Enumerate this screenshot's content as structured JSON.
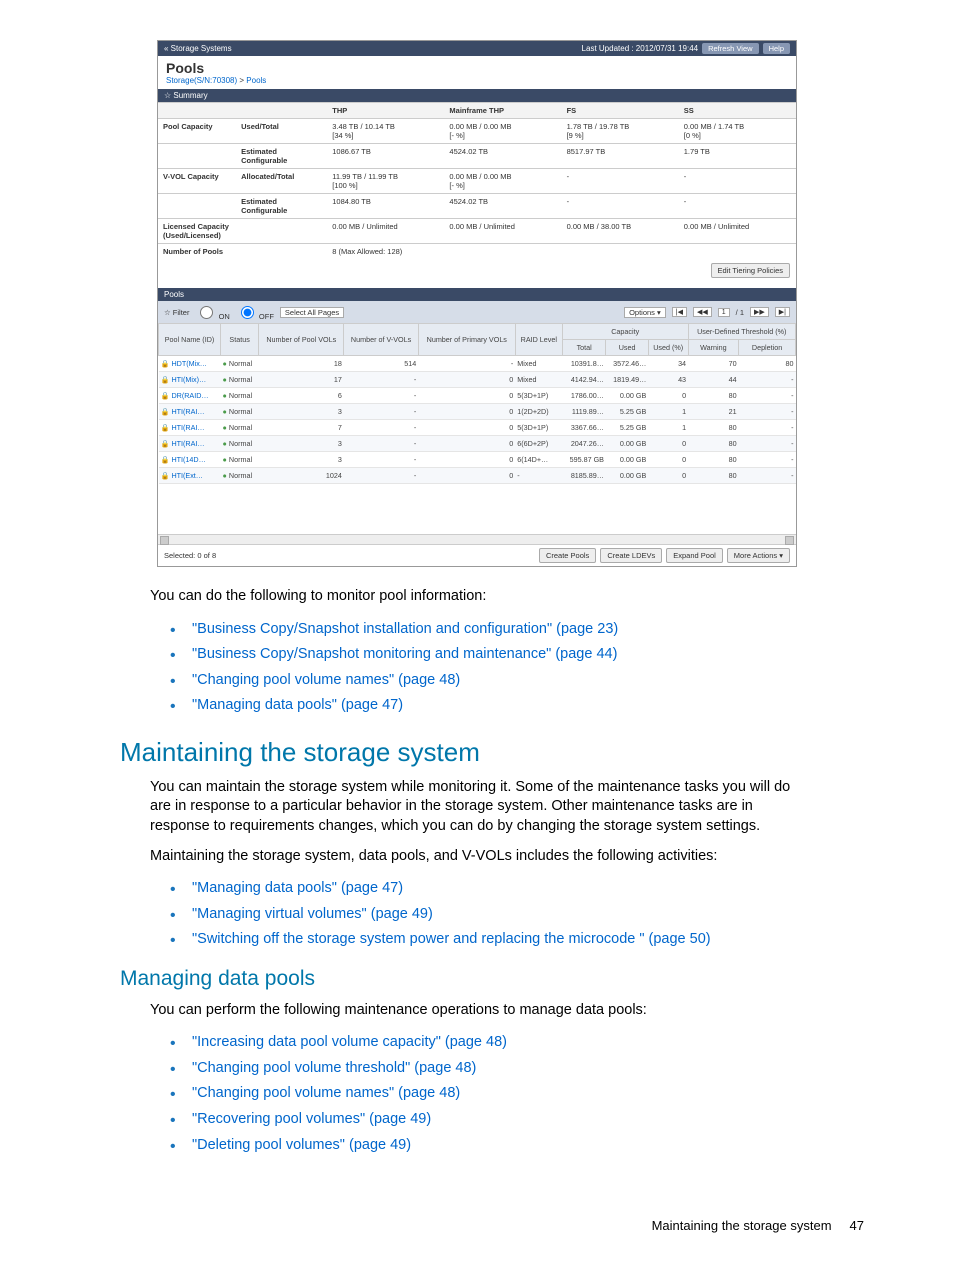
{
  "screenshot": {
    "topbar": {
      "back_label": "« Storage Systems",
      "last_updated": "Last Updated : 2012/07/31 19:44",
      "refresh": "Refresh View",
      "help": "Help"
    },
    "title": "Pools",
    "breadcrumb": {
      "link": "Storage(S/N:70308)",
      "sep": ">",
      "current": "Pools"
    },
    "summary": {
      "header": "☆ Summary",
      "cols": {
        "thp": "THP",
        "mf": "Mainframe THP",
        "fs": "FS",
        "ss": "SS"
      },
      "rows": [
        {
          "label": "Pool Capacity",
          "sub": "Used/Total",
          "thp": "3.48 TB / 10.14 TB",
          "thp_pct": "[34 %]",
          "mf": "0.00 MB / 0.00 MB",
          "mf_pct": "[- %]",
          "fs": "1.78 TB / 19.78 TB",
          "fs_pct": "[9 %]",
          "ss": "0.00 MB / 1.74 TB",
          "ss_pct": "[0 %]"
        },
        {
          "label": "",
          "sub": "Estimated Configurable",
          "thp": "1086.67 TB",
          "mf": "4524.02 TB",
          "fs": "8517.97 TB",
          "ss": "1.79 TB"
        },
        {
          "label": "V-VOL Capacity",
          "sub": "Allocated/Total",
          "thp": "11.99 TB / 11.99 TB",
          "thp_pct": "[100 %]",
          "mf": "0.00 MB / 0.00 MB",
          "mf_pct": "[- %]",
          "fs": "-",
          "ss": "-"
        },
        {
          "label": "",
          "sub": "Estimated Configurable",
          "thp": "1084.80 TB",
          "mf": "4524.02 TB",
          "fs": "-",
          "ss": "-"
        },
        {
          "label": "Licensed Capacity (Used/Licensed)",
          "sub": "",
          "thp": "0.00 MB / Unlimited",
          "mf": "0.00 MB / Unlimited",
          "fs": "0.00 MB / 38.00 TB",
          "ss": "0.00 MB / Unlimited"
        },
        {
          "label": "Number of Pools",
          "sub": "",
          "thp": "8 (Max Allowed: 128)",
          "mf": "",
          "fs": "",
          "ss": ""
        }
      ],
      "edit_btn": "Edit Tiering Policies"
    },
    "pools_section": {
      "header": "Pools",
      "filter": {
        "label": "☆ Filter",
        "on": "ON",
        "off": "OFF",
        "select_all": "Select All Pages",
        "options": "Options ▾",
        "first": "|◀",
        "prev": "◀◀",
        "page": "1",
        "total": "/ 1",
        "next": "▶▶",
        "last": "▶|"
      },
      "columns": {
        "name": "Pool Name (ID)",
        "status": "Status",
        "nvol": "Number of Pool VOLs",
        "nvvol": "Number of V-VOLs",
        "nprim": "Number of Primary VOLs",
        "raid": "RAID Level",
        "cap_group": "Capacity",
        "cap_total": "Total",
        "cap_used": "Used",
        "cap_usedpct": "Used (%)",
        "udt_group": "User-Defined Threshold (%)",
        "udt_warn": "Warning",
        "udt_depl": "Depletion"
      },
      "rows": [
        {
          "name": "HDT(Mix…",
          "status": "Normal",
          "nvol": "18",
          "nvvol": "514",
          "nprim": "-",
          "raid": "Mixed",
          "total": "10391.8…",
          "used": "3572.46…",
          "usedpct": "34",
          "warn": "70",
          "depl": "80"
        },
        {
          "name": "HTI(Mix)…",
          "status": "Normal",
          "nvol": "17",
          "nvvol": "-",
          "nprim": "0",
          "raid": "Mixed",
          "total": "4142.94…",
          "used": "1819.49…",
          "usedpct": "43",
          "warn": "44",
          "depl": "-"
        },
        {
          "name": "DR(RAID…",
          "status": "Normal",
          "nvol": "6",
          "nvvol": "-",
          "nprim": "0",
          "raid": "5(3D+1P)",
          "total": "1786.00…",
          "used": "0.00 GB",
          "usedpct": "0",
          "warn": "80",
          "depl": "-"
        },
        {
          "name": "HTI(RAI…",
          "status": "Normal",
          "nvol": "3",
          "nvvol": "-",
          "nprim": "0",
          "raid": "1(2D+2D)",
          "total": "1119.89…",
          "used": "5.25 GB",
          "usedpct": "1",
          "warn": "21",
          "depl": "-"
        },
        {
          "name": "HTI(RAI…",
          "status": "Normal",
          "nvol": "7",
          "nvvol": "-",
          "nprim": "0",
          "raid": "5(3D+1P)",
          "total": "3367.66…",
          "used": "5.25 GB",
          "usedpct": "1",
          "warn": "80",
          "depl": "-"
        },
        {
          "name": "HTI(RAI…",
          "status": "Normal",
          "nvol": "3",
          "nvvol": "-",
          "nprim": "0",
          "raid": "6(6D+2P)",
          "total": "2047.26…",
          "used": "0.00 GB",
          "usedpct": "0",
          "warn": "80",
          "depl": "-"
        },
        {
          "name": "HTI(14D…",
          "status": "Normal",
          "nvol": "3",
          "nvvol": "-",
          "nprim": "0",
          "raid": "6(14D+…",
          "total": "595.87 GB",
          "used": "0.00 GB",
          "usedpct": "0",
          "warn": "80",
          "depl": "-"
        },
        {
          "name": "HTI(Ext…",
          "status": "Normal",
          "nvol": "1024",
          "nvvol": "-",
          "nprim": "0",
          "raid": "-",
          "total": "8185.89…",
          "used": "0.00 GB",
          "usedpct": "0",
          "warn": "80",
          "depl": "-"
        }
      ],
      "selected": "Selected: 0 of 8",
      "buttons": {
        "create_pools": "Create Pools",
        "create_ldevs": "Create LDEVs",
        "expand": "Expand Pool",
        "more": "More Actions ▾"
      }
    }
  },
  "doc": {
    "p1": "You can do the following to monitor pool information:",
    "list1": [
      "\"Business Copy/Snapshot installation and configuration\" (page 23)",
      "\"Business Copy/Snapshot monitoring and maintenance\" (page 44)",
      "\"Changing pool volume names\" (page 48)",
      "\"Managing data pools\" (page 47)"
    ],
    "h2a": "Maintaining the storage system",
    "p2": "You can maintain the storage system while monitoring it. Some of the maintenance tasks you will do are in response to a particular behavior in the storage system. Other maintenance tasks are in response to requirements changes, which you can do by changing the storage system settings.",
    "p3": "Maintaining the storage system, data pools, and V-VOLs includes the following activities:",
    "list2": [
      "\"Managing data pools\" (page 47)",
      "\"Managing virtual volumes\" (page 49)",
      "\"Switching off the storage system power and replacing the microcode \" (page 50)"
    ],
    "h3a": "Managing data pools",
    "p4": "You can perform the following maintenance operations to manage data pools:",
    "list3": [
      "\"Increasing data pool volume capacity\" (page 48)",
      "\"Changing pool volume threshold\" (page 48)",
      "\"Changing pool volume names\" (page 48)",
      "\"Recovering pool volumes\" (page 49)",
      "\"Deleting pool volumes\" (page 49)"
    ],
    "footer_text": "Maintaining the storage system",
    "footer_page": "47"
  }
}
